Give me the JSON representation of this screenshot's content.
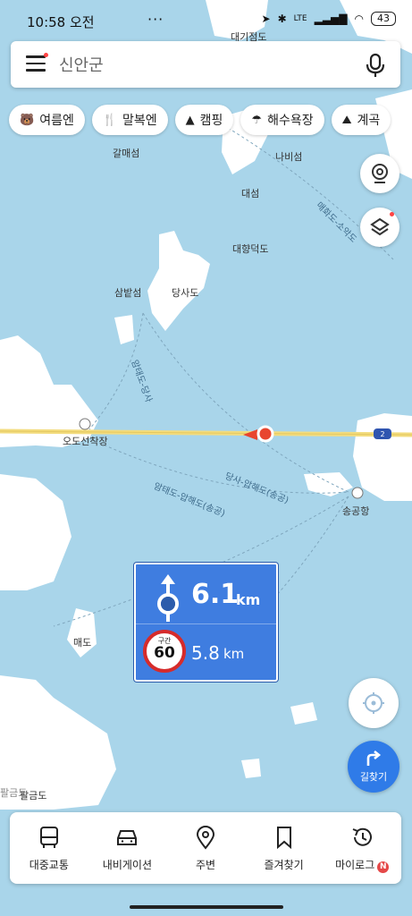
{
  "status_bar": {
    "time": "10:58 오전",
    "dots": "···",
    "network": "LTE",
    "battery": "43"
  },
  "search": {
    "query": "신안군"
  },
  "chips": [
    {
      "icon": "bear-icon",
      "label": "여름엔"
    },
    {
      "icon": "utensils-icon",
      "label": "말복엔"
    },
    {
      "icon": "tent-icon",
      "label": "캠핑"
    },
    {
      "icon": "umbrella-icon",
      "label": "해수욕장"
    },
    {
      "icon": "mountain-icon",
      "label": "계곡"
    }
  ],
  "map_labels": {
    "daegijeomdo": "대기점도",
    "galmaeseom": "갈매섬",
    "nabiseom": "나비섬",
    "daeseom": "대섬",
    "daehyangdeokdo": "대향덕도",
    "sambatseom": "삼밭섬",
    "dangsado": "당사도",
    "odoseonchakjang": "오도선착장",
    "songgonghang": "송공항",
    "maedo": "매도",
    "palgeumdo": "팔금도",
    "palgeumdo_alt": "팔금도",
    "route_1": "매화도-소악도",
    "route_2": "암태도-당사",
    "route_3": "당사-압해도(송공)",
    "route_4": "암태도-압해도(송공)",
    "road_number": "2"
  },
  "navigation_sign": {
    "distance_1": "6.1",
    "unit_1": "km",
    "section_label": "구간",
    "speed_limit": "60",
    "distance_2": "5.8",
    "unit_2": "km"
  },
  "directions_button": {
    "label": "길찾기"
  },
  "bottom_nav": [
    {
      "icon": "bus-icon",
      "label": "대중교통"
    },
    {
      "icon": "car-icon",
      "label": "내비게이션"
    },
    {
      "icon": "pin-icon",
      "label": "주변"
    },
    {
      "icon": "bookmark-icon",
      "label": "즐겨찾기"
    },
    {
      "icon": "history-icon",
      "label": "마이로그",
      "badge": "N"
    }
  ],
  "colors": {
    "water": "#a9d5ea",
    "land": "#ffffff",
    "accent": "#3f7de0",
    "road": "#f3dc7e",
    "marker": "#e8452f"
  }
}
